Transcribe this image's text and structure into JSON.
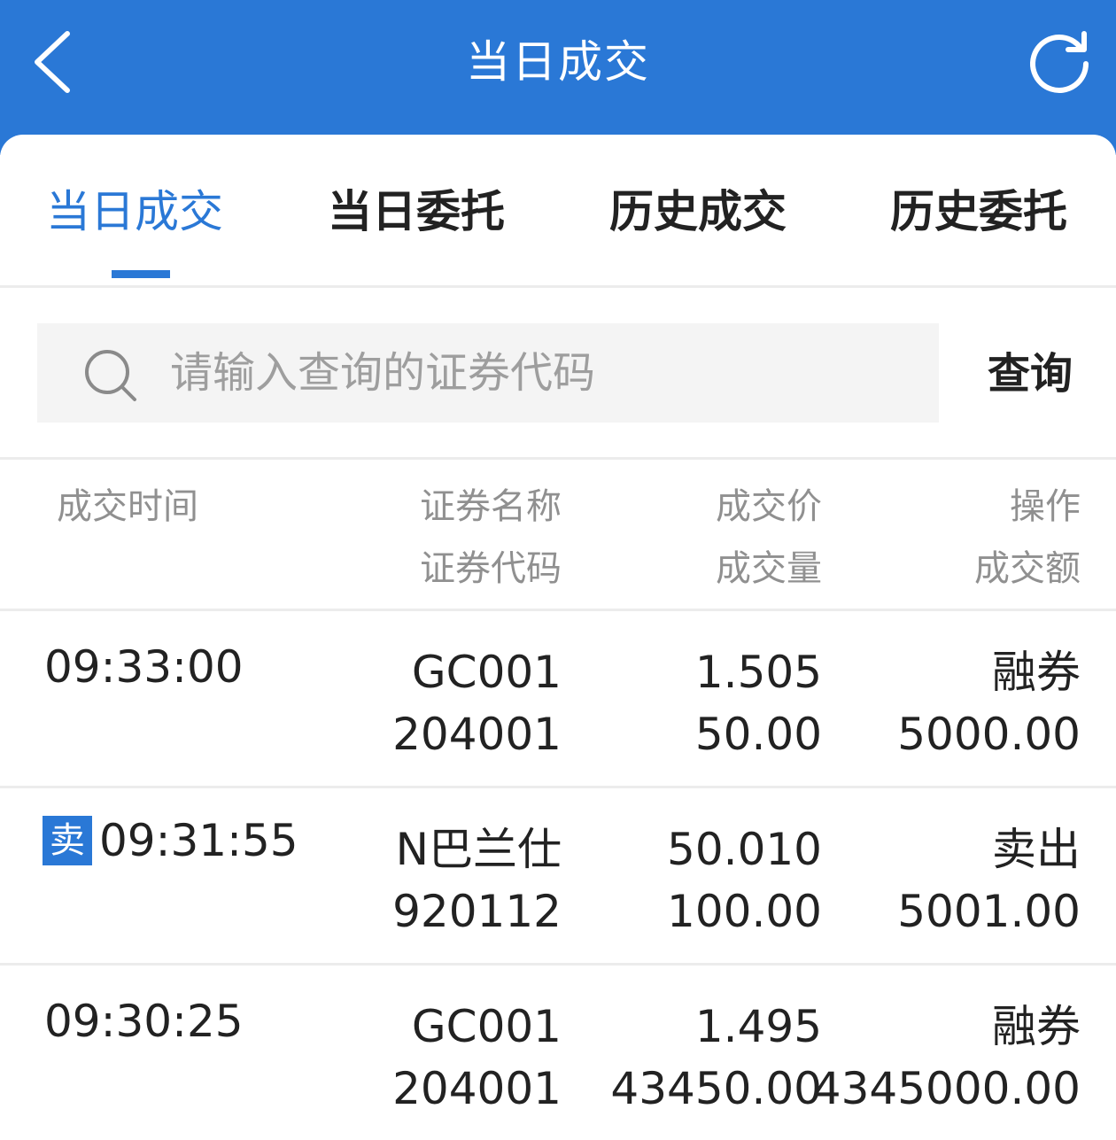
{
  "header": {
    "title": "当日成交"
  },
  "tabs": [
    {
      "label": "当日成交",
      "active": true
    },
    {
      "label": "当日委托",
      "active": false
    },
    {
      "label": "历史成交",
      "active": false
    },
    {
      "label": "历史委托",
      "active": false
    }
  ],
  "search": {
    "placeholder": "请输入查询的证券代码",
    "value": "",
    "button_label": "查询"
  },
  "columns": {
    "time": "成交时间",
    "name": "证券名称",
    "code": "证券代码",
    "price": "成交价",
    "volume": "成交量",
    "op": "操作",
    "amount": "成交额"
  },
  "trades": [
    {
      "badge": "",
      "time": "09:33:00",
      "name": "GC001",
      "code": "204001",
      "price": "1.505",
      "volume": "50.00",
      "op": "融券",
      "amount": "5000.00"
    },
    {
      "badge": "卖",
      "time": "09:31:55",
      "name": "N巴兰仕",
      "code": "920112",
      "price": "50.010",
      "volume": "100.00",
      "op": "卖出",
      "amount": "5001.00"
    },
    {
      "badge": "",
      "time": "09:30:25",
      "name": "GC001",
      "code": "204001",
      "price": "1.495",
      "volume": "43450.00",
      "op": "融券",
      "amount": "4345000.00"
    }
  ],
  "colors": {
    "primary": "#2a78d6",
    "muted_text": "#909090",
    "divider": "#ececec"
  },
  "icons": {
    "back": "chevron-left-icon",
    "refresh": "refresh-icon",
    "search": "search-icon"
  }
}
